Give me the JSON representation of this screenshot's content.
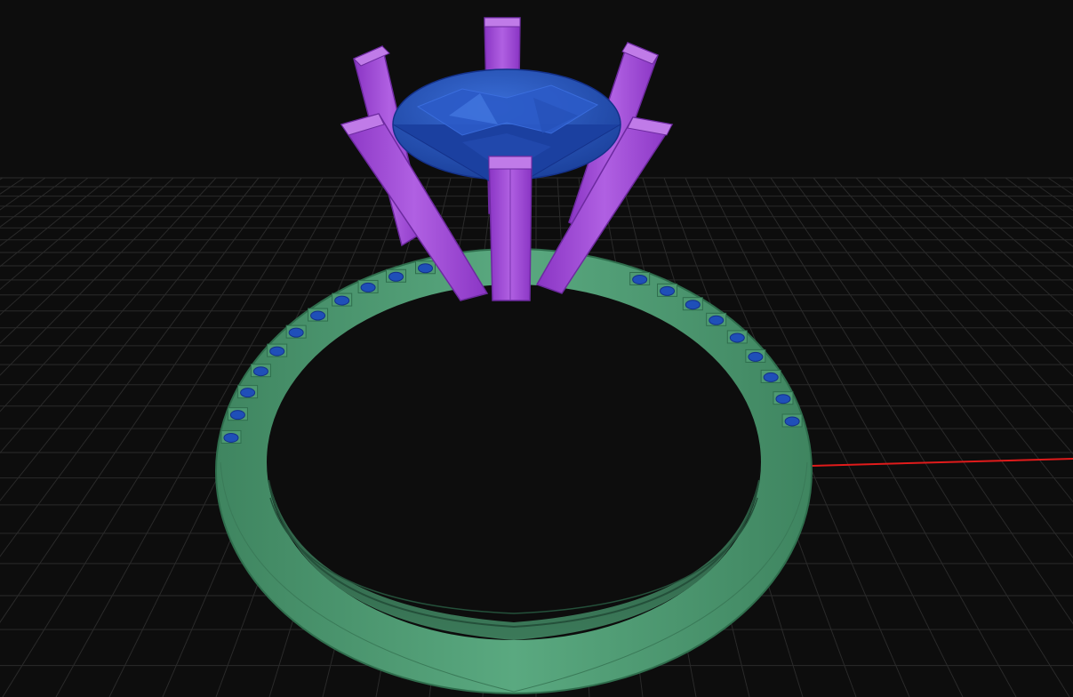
{
  "viewport": {
    "background_color": "#0d0d0d",
    "grid_color": "#2a2a2a",
    "grid_visible": true
  },
  "axes": {
    "x_axis_color": "#e01b1b",
    "y_axis_color": "#17b317"
  },
  "model": {
    "band_color": "#4e9a72",
    "band_shadow_color": "#2e6b4c",
    "prong_color": "#9b3fd3",
    "prong_highlight_color": "#b45ee6",
    "gem_color": "#1f4fb8",
    "gem_highlight_color": "#3a6ed8",
    "prong_count": 6
  }
}
